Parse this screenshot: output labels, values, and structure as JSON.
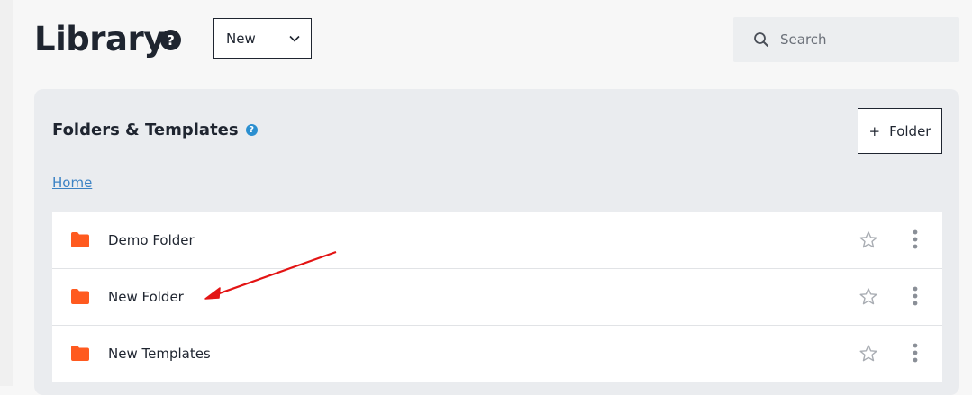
{
  "header": {
    "title": "Library",
    "help_icon": "question-circle-icon",
    "new_dropdown": {
      "selected": "New"
    },
    "search": {
      "placeholder": "Search"
    }
  },
  "panel": {
    "title": "Folders & Templates",
    "add_folder_button": {
      "plus": "+",
      "label": "Folder"
    },
    "breadcrumb": "Home",
    "items": [
      {
        "label": "Demo Folder"
      },
      {
        "label": "New Folder"
      },
      {
        "label": "New Templates"
      }
    ]
  },
  "colors": {
    "folder": "#ff5a1f",
    "accent_link": "#3b82c4",
    "annotation_arrow": "#e31414"
  }
}
